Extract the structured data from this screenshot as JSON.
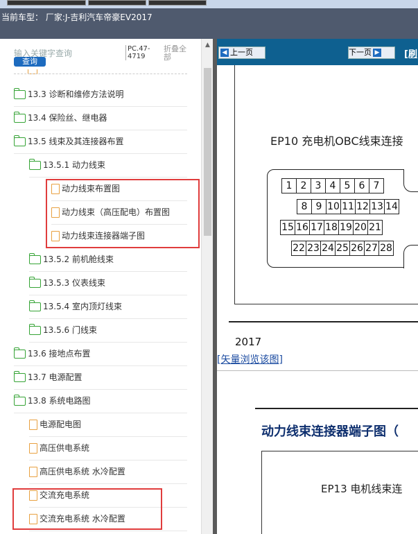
{
  "header": {
    "car_model": "当前车型： 厂家:J-吉利汽车帝豪EV2017"
  },
  "search": {
    "placeholder": "输入关键字查询",
    "button": "查询",
    "code": "PC.47-4719",
    "fold": "折叠全部"
  },
  "tree": {
    "items": [
      {
        "label": "13.3 诊断和维修方法说明",
        "type": "folder"
      },
      {
        "label": "13.4 保险丝、继电器",
        "type": "folder"
      },
      {
        "label": "13.5 线束及其连接器布置",
        "type": "folder"
      },
      {
        "label": "13.5.1 动力线束",
        "type": "folder"
      },
      {
        "label": "动力线束布置图",
        "type": "doc"
      },
      {
        "label": "动力线束（高压配电）布置图",
        "type": "doc"
      },
      {
        "label": "动力线束连接器端子图",
        "type": "doc"
      },
      {
        "label": "13.5.2 前机舱线束",
        "type": "folder"
      },
      {
        "label": "13.5.3 仪表线束",
        "type": "folder"
      },
      {
        "label": "13.5.4 室内顶灯线束",
        "type": "folder"
      },
      {
        "label": "13.5.6 门线束",
        "type": "folder"
      },
      {
        "label": "13.6 接地点布置",
        "type": "folder"
      },
      {
        "label": "13.7 电源配置",
        "type": "folder"
      },
      {
        "label": "13.8 系统电路图",
        "type": "folder"
      },
      {
        "label": "电源配电图",
        "type": "doc"
      },
      {
        "label": "高压供电系统",
        "type": "doc"
      },
      {
        "label": "高压供电系统 水冷配置",
        "type": "doc"
      },
      {
        "label": "交流充电系统",
        "type": "doc"
      },
      {
        "label": "交流充电系统 水冷配置",
        "type": "doc"
      }
    ]
  },
  "nav": {
    "prev": "上一页",
    "next": "下一页",
    "refresh": "[刷"
  },
  "doc": {
    "ep10_title": "EP10 充电机OBC线束连接",
    "pins": [
      "1",
      "2",
      "3",
      "4",
      "5",
      "6",
      "7",
      "8",
      "9",
      "10",
      "11",
      "12",
      "13",
      "14",
      "15",
      "16",
      "17",
      "18",
      "19",
      "20",
      "21",
      "22",
      "23",
      "24",
      "25",
      "26",
      "27",
      "28"
    ],
    "year": "2017",
    "vector_link": "[矢量浏览该图]",
    "section_title": "动力线束连接器端子图（",
    "ep13_title": "EP13 电机线束连"
  },
  "colors": {
    "highlight": "#e03c3c",
    "navbar": "#0e6090",
    "folder": "#35a335",
    "doc": "#e8a040"
  }
}
